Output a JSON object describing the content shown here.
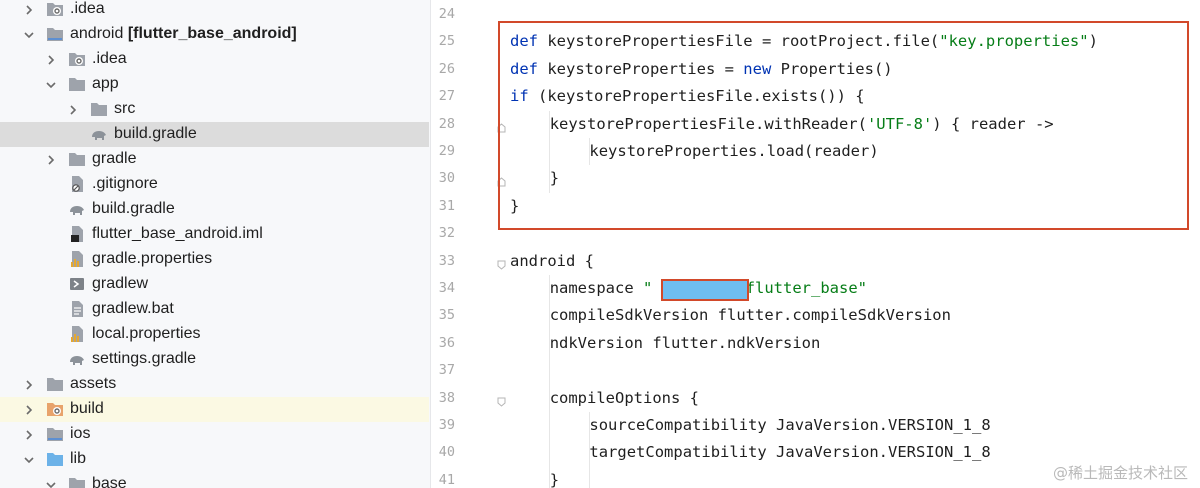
{
  "tree": [
    {
      "label": "",
      "label2": ".idea",
      "icon": "folder-gear-icon",
      "chev": "right",
      "depth": 1
    },
    {
      "label": "android ",
      "label2": "[flutter_base_android]",
      "icon": "folder-module-icon",
      "chev": "down",
      "depth": 1
    },
    {
      "label": "",
      "label2": ".idea",
      "icon": "folder-gear-icon",
      "chev": "right",
      "depth": 2
    },
    {
      "label": "",
      "label2": "app",
      "icon": "folder-icon",
      "chev": "down",
      "depth": 2
    },
    {
      "label": "",
      "label2": "src",
      "icon": "folder-icon",
      "chev": "right",
      "depth": 3
    },
    {
      "label": "",
      "label2": "build.gradle",
      "icon": "gradle-elephant-icon",
      "chev": "none",
      "depth": 3,
      "selected": true
    },
    {
      "label": "",
      "label2": "gradle",
      "icon": "folder-icon",
      "chev": "right",
      "depth": 2
    },
    {
      "label": "",
      "label2": ".gitignore",
      "icon": "gitignore-file-icon",
      "chev": "none",
      "depth": 2
    },
    {
      "label": "",
      "label2": "build.gradle",
      "icon": "gradle-elephant-icon",
      "chev": "none",
      "depth": 2
    },
    {
      "label": "",
      "label2": "flutter_base_android.iml",
      "icon": "iml-file-icon",
      "chev": "none",
      "depth": 2
    },
    {
      "label": "",
      "label2": "gradle.properties",
      "icon": "properties-file-icon",
      "chev": "none",
      "depth": 2
    },
    {
      "label": "",
      "label2": "gradlew",
      "icon": "script-file-icon",
      "chev": "none",
      "depth": 2
    },
    {
      "label": "",
      "label2": "gradlew.bat",
      "icon": "text-file-icon",
      "chev": "none",
      "depth": 2
    },
    {
      "label": "",
      "label2": "local.properties",
      "icon": "properties-file-icon",
      "chev": "none",
      "depth": 2
    },
    {
      "label": "",
      "label2": "settings.gradle",
      "icon": "gradle-elephant-icon",
      "chev": "none",
      "depth": 2
    },
    {
      "label": "",
      "label2": "assets",
      "icon": "folder-icon",
      "chev": "right",
      "depth": 1
    },
    {
      "label": "",
      "label2": "build",
      "icon": "folder-orange-icon",
      "chev": "right",
      "depth": 1,
      "highlighted": true
    },
    {
      "label": "",
      "label2": "ios",
      "icon": "folder-module-icon",
      "chev": "right",
      "depth": 1
    },
    {
      "label": "",
      "label2": "lib",
      "icon": "folder-blue-icon",
      "chev": "down",
      "depth": 1
    },
    {
      "label": "",
      "label2": "base",
      "icon": "folder-icon",
      "chev": "down",
      "depth": 2
    }
  ],
  "code_lines": [
    {
      "n": "24",
      "indent": 0,
      "parts": []
    },
    {
      "n": "25",
      "indent": 0,
      "parts": [
        [
          "kw",
          "def "
        ],
        [
          "",
          "keystorePropertiesFile = rootProject.file("
        ],
        [
          "str",
          "\"key.properties\""
        ],
        [
          "",
          ")"
        ]
      ]
    },
    {
      "n": "26",
      "indent": 0,
      "parts": [
        [
          "kw",
          "def "
        ],
        [
          "",
          "keystoreProperties = "
        ],
        [
          "kw",
          "new "
        ],
        [
          "",
          "Properties()"
        ]
      ]
    },
    {
      "n": "27",
      "indent": 0,
      "parts": [
        [
          "kw",
          "if "
        ],
        [
          "",
          "(keystorePropertiesFile.exists()) {"
        ]
      ]
    },
    {
      "n": "28",
      "indent": 1,
      "parts": [
        [
          "",
          "keystorePropertiesFile.withReader("
        ],
        [
          "str",
          "'UTF-8'"
        ],
        [
          "",
          ") { reader ->"
        ]
      ]
    },
    {
      "n": "29",
      "indent": 2,
      "parts": [
        [
          "",
          "keystoreProperties.load(reader)"
        ]
      ]
    },
    {
      "n": "30",
      "indent": 1,
      "parts": [
        [
          "",
          "}"
        ]
      ]
    },
    {
      "n": "31",
      "indent": 0,
      "parts": [
        [
          "",
          "}"
        ]
      ]
    },
    {
      "n": "32",
      "indent": 0,
      "parts": []
    },
    {
      "n": "33",
      "indent": 0,
      "parts": [
        [
          "",
          "android {"
        ]
      ]
    },
    {
      "n": "34",
      "indent": 1,
      "parts": [
        [
          "",
          "namespace "
        ],
        [
          "str",
          "\""
        ],
        [
          "str",
          "          "
        ],
        [
          "str",
          "flutter_base\""
        ]
      ]
    },
    {
      "n": "35",
      "indent": 1,
      "parts": [
        [
          "",
          "compileSdkVersion flutter.compileSdkVersion"
        ]
      ]
    },
    {
      "n": "36",
      "indent": 1,
      "parts": [
        [
          "",
          "ndkVersion flutter.ndkVersion"
        ]
      ]
    },
    {
      "n": "37",
      "indent": 0,
      "parts": []
    },
    {
      "n": "38",
      "indent": 1,
      "parts": [
        [
          "",
          "compileOptions {"
        ]
      ]
    },
    {
      "n": "39",
      "indent": 2,
      "parts": [
        [
          "",
          "sourceCompatibility JavaVersion.VERSION_1_8"
        ]
      ]
    },
    {
      "n": "40",
      "indent": 2,
      "parts": [
        [
          "",
          "targetCompatibility JavaVersion.VERSION_1_8"
        ]
      ]
    },
    {
      "n": "41",
      "indent": 1,
      "parts": [
        [
          "",
          "}"
        ]
      ]
    }
  ],
  "watermark": "@稀土掘金技术社区",
  "colors": {
    "highlight_box": "#d2492a",
    "redaction": "#6fbdf0",
    "keyword": "#0033b3",
    "string": "#067d17"
  }
}
